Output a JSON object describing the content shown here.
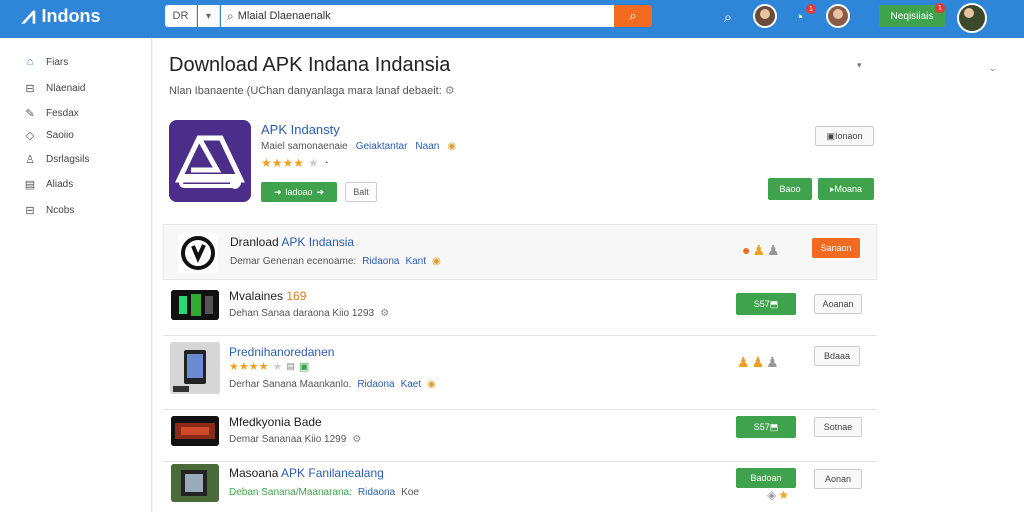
{
  "header": {
    "logo_text": "Indons",
    "search_prefix": "DR",
    "search_value": "Mlaial Dlaenaenalk",
    "register_label": "Neqisiiais",
    "notif_count_1": "1",
    "notif_count_2": "1"
  },
  "sidebar": {
    "items": [
      {
        "label": "Fiars",
        "icon": "home-icon"
      },
      {
        "label": "Nlaenaid",
        "icon": "download-icon"
      },
      {
        "label": "Fesdax",
        "icon": "tools-icon"
      },
      {
        "label": "Saoiio",
        "icon": "tag-icon"
      },
      {
        "label": "Dsrlagsils",
        "icon": "user-icon"
      },
      {
        "label": "Aliads",
        "icon": "book-icon"
      },
      {
        "label": "Ncobs",
        "icon": "minus-box-icon"
      }
    ]
  },
  "page": {
    "title": "Download APK Indana Indansia",
    "subtitle": "Nlan Ibanaente (UChan danyanlaga mara lanaf debaeit:"
  },
  "featured": {
    "name": "APK Indansty",
    "meta_left": "Maiel samonaenaie",
    "meta_right": "Geiaktantar",
    "meta_link": "Naan",
    "rating_count": "",
    "download_label": "ladoao",
    "version_label": "Balt",
    "top_right_btn": "Ionaon",
    "action_green_1": "Baoo",
    "action_green_2": "Moana"
  },
  "rows": [
    {
      "title_pre": "Dranload ",
      "title_acc": "APK Indansia",
      "desc": "Demar Genenan ecenoame:",
      "link": "Ridaona",
      "tail": "Kant",
      "action_label": "Sanaon"
    },
    {
      "title_pre": "Mvalaines ",
      "title_num": "169",
      "desc": "Dehan Sanaa daraona Kiio 1293",
      "green_label": "S57",
      "action_label": "Aoanan"
    },
    {
      "title_acc": "Prednihanoredanen",
      "desc": "Derhar Sanana Maankanlo.",
      "link": "Ridaona",
      "tail": "Kaet",
      "action_label": "Bdaaa"
    },
    {
      "title_pre": "Mfedkyonia Bade",
      "desc": "Demar Sananaa Kiio 1299",
      "green_label": "S57",
      "action_label": "Sotnae"
    },
    {
      "title_pre": "Masoana ",
      "title_acc": "APK Fanilanealang",
      "desc": "Deban Sanana/Maanarana:",
      "link": "Ridaona",
      "tail": "Koe",
      "green_label": "Badoan",
      "action_label": "Aonan"
    }
  ],
  "colors": {
    "brand_blue": "#2f86d8",
    "accent_orange": "#f26b21",
    "action_green": "#3fa34d"
  }
}
